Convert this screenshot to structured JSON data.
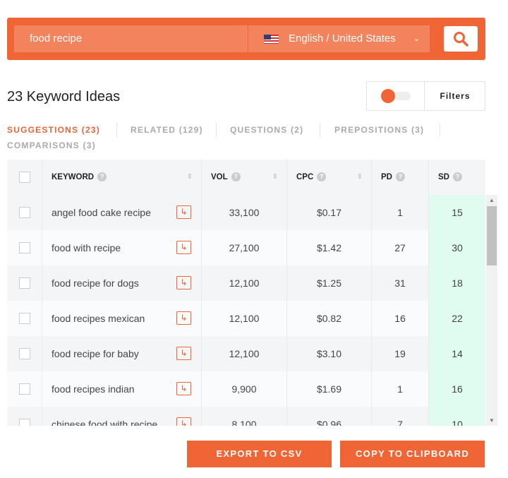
{
  "search": {
    "query": "food recipe",
    "language": "English / United States"
  },
  "header": {
    "title": "23 Keyword Ideas",
    "filters_label": "Filters",
    "toggle_on": false
  },
  "tabs": [
    {
      "label": "SUGGESTIONS (23)",
      "active": true
    },
    {
      "label": "RELATED (129)"
    },
    {
      "label": "QUESTIONS (2)"
    },
    {
      "label": "PREPOSITIONS (3)"
    },
    {
      "label": "COMPARISONS (3)"
    }
  ],
  "table": {
    "columns": [
      "KEYWORD",
      "VOL",
      "CPC",
      "PD",
      "SD"
    ],
    "rows": [
      {
        "keyword": "angel food cake recipe",
        "vol": "33,100",
        "cpc": "$0.17",
        "pd": "1",
        "sd": "15"
      },
      {
        "keyword": "food with recipe",
        "vol": "27,100",
        "cpc": "$1.42",
        "pd": "27",
        "sd": "30"
      },
      {
        "keyword": "food recipe for dogs",
        "vol": "12,100",
        "cpc": "$1.25",
        "pd": "31",
        "sd": "18"
      },
      {
        "keyword": "food recipes mexican",
        "vol": "12,100",
        "cpc": "$0.82",
        "pd": "16",
        "sd": "22"
      },
      {
        "keyword": "food recipe for baby",
        "vol": "12,100",
        "cpc": "$3.10",
        "pd": "19",
        "sd": "14"
      },
      {
        "keyword": "food recipes indian",
        "vol": "9,900",
        "cpc": "$1.69",
        "pd": "1",
        "sd": "16"
      },
      {
        "keyword": "chinese food with recipe",
        "vol": "8,100",
        "cpc": "$0.96",
        "pd": "7",
        "sd": "10"
      }
    ]
  },
  "actions": {
    "export": "EXPORT TO CSV",
    "copy": "COPY TO CLIPBOARD"
  },
  "colors": {
    "accent": "#f06535",
    "sd_bg": "#e0fbef"
  }
}
